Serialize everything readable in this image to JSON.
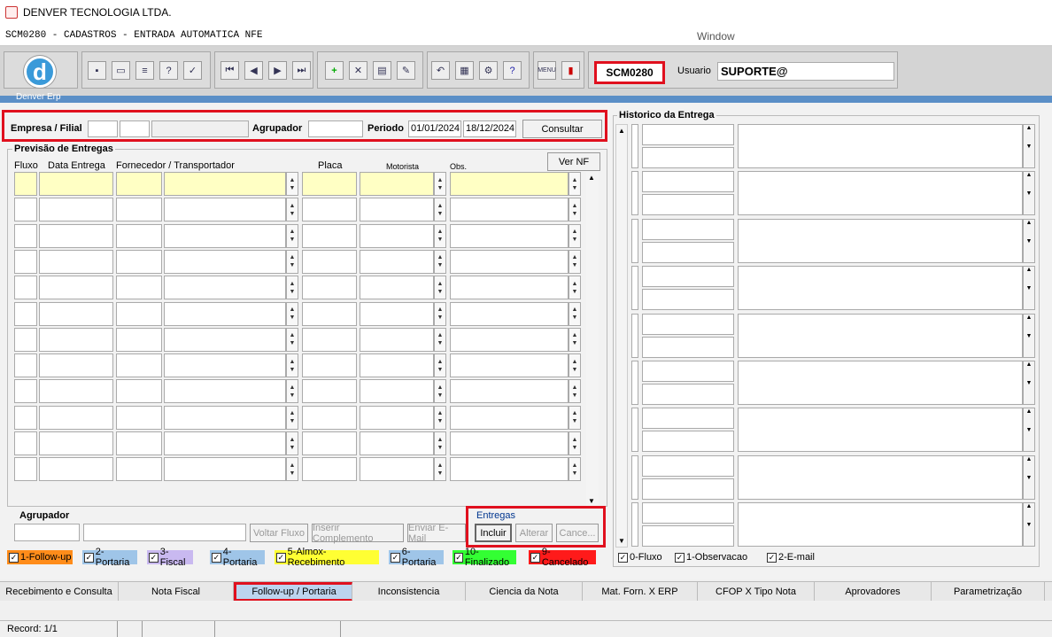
{
  "window": {
    "title": "DENVER TECNOLOGIA LTDA.",
    "form_title": "SCM0280 - CADASTROS - ENTRADA AUTOMATICA NFE",
    "menu_window": "Window"
  },
  "toolbar": {
    "form_code": "SCM0280",
    "usuario_label": "Usuario",
    "usuario_value": "SUPORTE@",
    "logo_letter": "d"
  },
  "frame_title": "Denver Erp",
  "filter": {
    "empresa_label": "Empresa / Filial",
    "agrupador_label": "Agrupador",
    "periodo_label": "Periodo",
    "date_from": "01/01/2024",
    "date_to": "18/12/2024",
    "consultar_label": "Consultar"
  },
  "previsao": {
    "title": "Previsão de Entregas",
    "ver_nf_label": "Ver NF",
    "columns": [
      "Fluxo",
      "Data Entrega",
      "Fornecedor / Transportador",
      "Placa",
      "Motorista",
      "Obs."
    ]
  },
  "bottom": {
    "agrupador_label": "Agrupador",
    "voltar_fluxo": "Voltar Fluxo",
    "inserir_complemento": "Inserir Complemento",
    "enviar_email": "Enviar E-Mail",
    "entregas_title": "Entregas",
    "incluir": "Incluir",
    "alterar": "Alterar",
    "cancelar": "Cance..."
  },
  "legend": [
    {
      "label": "1-Follow-up",
      "color": "#ff8c1a"
    },
    {
      "label": "2-Portaria",
      "color": "#9fc5e8"
    },
    {
      "label": "3-Fiscal",
      "color": "#c9b9f0"
    },
    {
      "label": "4-Portaria",
      "color": "#9fc5e8"
    },
    {
      "label": "5-Almox-Recebimento",
      "color": "#ffff33"
    },
    {
      "label": "6-Portaria",
      "color": "#9fc5e8"
    },
    {
      "label": "10-Finalizado",
      "color": "#33ff33"
    },
    {
      "label": "9-Cancelado",
      "color": "#ff1a1a"
    }
  ],
  "historico": {
    "title": "Historico da Entrega",
    "checks": [
      "0-Fluxo",
      "1-Observacao",
      "2-E-mail"
    ]
  },
  "tabs": [
    "Recebimento e Consulta",
    "Nota Fiscal",
    "Follow-up / Portaria",
    "Inconsistencia",
    "Ciencia da Nota",
    "Mat. Forn. X ERP",
    "CFOP X Tipo Nota",
    "Aprovadores",
    "Parametrização"
  ],
  "status": {
    "record": "Record: 1/1"
  }
}
